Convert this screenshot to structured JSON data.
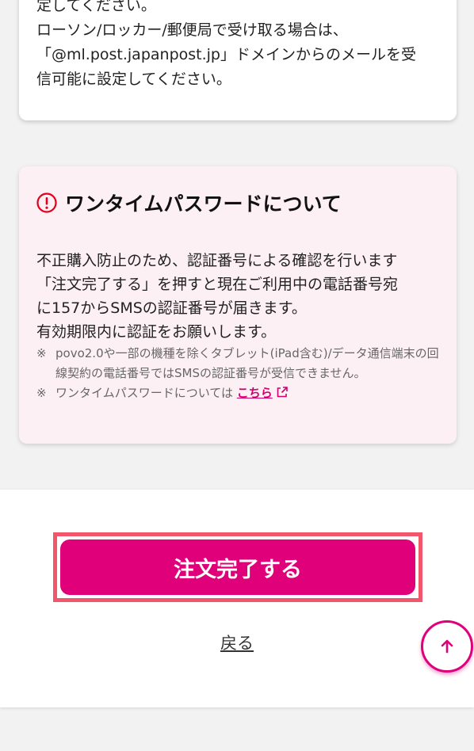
{
  "mail_notice": {
    "lines": [
      "定してください。",
      "ローソン/ロッカー/郵便局で受け取る場合は、",
      "「@ml.post.japanpost.jp」ドメインからのメールを受",
      "信可能に設定してください。"
    ]
  },
  "otp": {
    "title": "ワンタイムパスワードについて",
    "body_lines": [
      "不正購入防止のため、認証番号による確認を行います",
      "「注文完了する」を押すと現在ご利用中の電話番号宛",
      "に157からSMSの認証番号が届きます。",
      "有効期限内に認証をお願いします。"
    ],
    "note_mark": "※",
    "note1": "povo2.0や一部の機種を除くタブレット(iPad含む)/データ通信端末の回線契約の電話番号ではSMSの認証番号が受信できません。",
    "note2_prefix": "ワンタイムパスワードについては ",
    "note2_link": "こちら"
  },
  "actions": {
    "complete_label": "注文完了する",
    "back_label": "戻る"
  },
  "icons": {
    "warning": "exclamation-circle-icon",
    "external": "external-link-icon",
    "scroll_top": "arrow-up-icon"
  },
  "colors": {
    "accent": "#e0007a",
    "highlight_outline": "#f2566a",
    "warning_red": "#e2001a",
    "otp_bg": "#fdf0f4"
  }
}
